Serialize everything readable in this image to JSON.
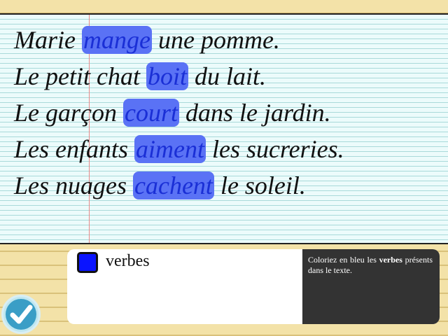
{
  "sentences": [
    {
      "before": "Marie ",
      "verb": "mange",
      "after": " une pomme."
    },
    {
      "before": "Le petit chat ",
      "verb": "boit",
      "after": " du lait."
    },
    {
      "before": "Le garçon ",
      "verb": "court",
      "after": " dans le jardin."
    },
    {
      "before": "Les enfants ",
      "verb": "aiment",
      "after": " les sucreries."
    },
    {
      "before": "Les nuages ",
      "verb": "cachent",
      "after": " le soleil."
    }
  ],
  "legend": {
    "label": "verbes",
    "color": "#0a14ff"
  },
  "instructions": {
    "prefix": "Coloriez en bleu les ",
    "bold": "verbes",
    "suffix": " présents dans le texte."
  },
  "check_button": {
    "icon": "checkmark-icon"
  },
  "colors": {
    "highlight": "#5a72f5",
    "verb_text": "#1a2fd6"
  }
}
